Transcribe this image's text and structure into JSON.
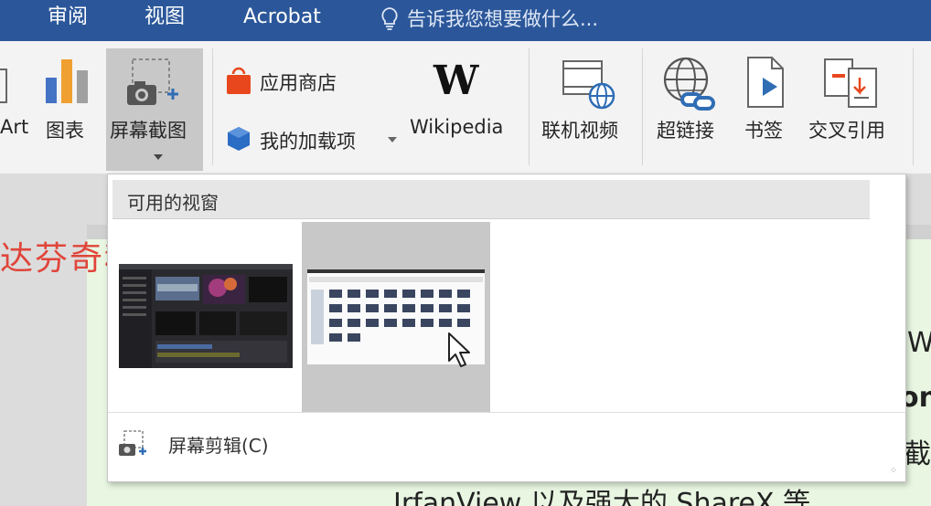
{
  "menubar": {
    "tabs": [
      "审阅",
      "视图",
      "Acrobat"
    ],
    "tell_me": "告诉我您想要做什么..."
  },
  "ribbon": {
    "smartart_label": "Art",
    "chart_label": "图表",
    "screenshot_label": "屏幕截图",
    "store_label": "应用商店",
    "my_addins_label": "我的加载项",
    "wikipedia_label": "Wikipedia",
    "online_video_label": "联机视频",
    "hyperlink_label": "超链接",
    "bookmark_label": "书签",
    "cross_ref_label": "交叉引用"
  },
  "dropdown": {
    "header": "可用的视窗",
    "clip_label": "屏幕剪辑(C)"
  },
  "document": {
    "watermark": "达芬奇科普",
    "bottom_text": "IrfanView 以及强大的 ShareX 等，",
    "frag_w": "W",
    "frag_on": "on",
    "frag_cut": "截图"
  },
  "colors": {
    "accent": "#2b579a",
    "watermark": "#e0453a",
    "doc_bg": "#e9f7e2"
  }
}
